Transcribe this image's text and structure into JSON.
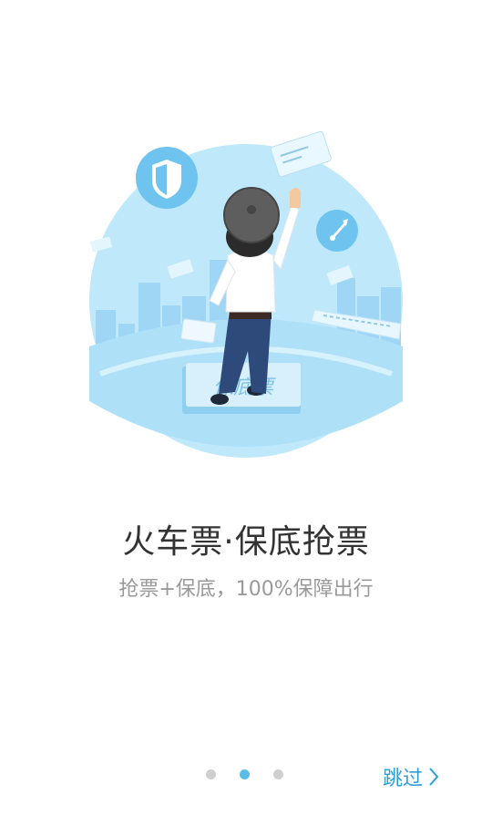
{
  "slide": {
    "title": "火车票·保底抢票",
    "subtitle": "抢票+保底，100%保障出行",
    "badge_text": "保底票",
    "icons": [
      "shield-icon",
      "rocket-icon",
      "ticket-icon",
      "train-icon"
    ]
  },
  "pager": {
    "count": 3,
    "active_index": 1
  },
  "skip": {
    "label": "跳过",
    "icon": "chevron-right-icon"
  },
  "colors": {
    "accent": "#2a9fd8",
    "circle": "#bfe8fb",
    "dot_active": "#5bbde7",
    "dot_inactive": "#cfcfcf"
  }
}
